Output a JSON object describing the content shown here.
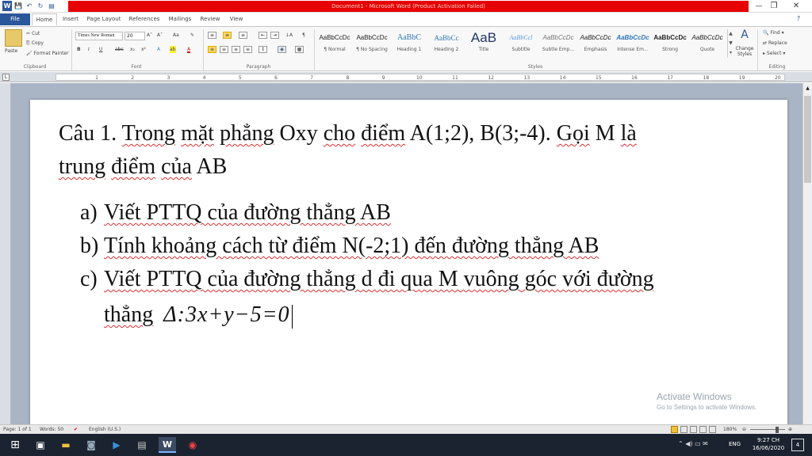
{
  "window": {
    "title": "Document1 - Microsoft Word (Product Activation Failed)",
    "app_icon": "W",
    "minimize": "—",
    "restore": "❐",
    "close": "✕",
    "help": "?"
  },
  "qat": {
    "save": "💾",
    "undo": "↶",
    "redo": "↻",
    "print": "▤"
  },
  "tabs": [
    {
      "label": "File"
    },
    {
      "label": "Home"
    },
    {
      "label": "Insert"
    },
    {
      "label": "Page Layout"
    },
    {
      "label": "References"
    },
    {
      "label": "Mailings"
    },
    {
      "label": "Review"
    },
    {
      "label": "View"
    }
  ],
  "clipboard": {
    "paste": "Paste",
    "cut": "Cut",
    "copy": "Copy",
    "format_painter": "Format Painter",
    "group": "Clipboard"
  },
  "font": {
    "name": "Times New Roman",
    "size": "20",
    "group": "Font",
    "bold": "B",
    "italic": "I",
    "underline": "U",
    "strike": "abc",
    "sub": "x₂",
    "sup": "x²",
    "grow": "A˄",
    "shrink": "A˅",
    "case": "Aa",
    "clear": "✎",
    "effects": "A",
    "highlight": "ab",
    "color": "A"
  },
  "paragraph": {
    "group": "Paragraph",
    "show": "¶",
    "sort": "↓A"
  },
  "styles": {
    "group": "Styles",
    "items": [
      {
        "preview": "AaBbCcDc",
        "name": "¶ Normal"
      },
      {
        "preview": "AaBbCcDc",
        "name": "¶ No Spacing"
      },
      {
        "preview": "AaBbC",
        "name": "Heading 1"
      },
      {
        "preview": "AaBbCc",
        "name": "Heading 2"
      },
      {
        "preview": "AaB",
        "name": "Title"
      },
      {
        "preview": "AaBbCcl",
        "name": "Subtitle"
      },
      {
        "preview": "AaBbCcDc",
        "name": "Subtle Emp..."
      },
      {
        "preview": "AaBbCcDc",
        "name": "Emphasis"
      },
      {
        "preview": "AaBbCcDc",
        "name": "Intense Em..."
      },
      {
        "preview": "AaBbCcDc",
        "name": "Strong"
      },
      {
        "preview": "AaBbCcDc",
        "name": "Quote"
      }
    ],
    "change": "Change Styles"
  },
  "editing": {
    "group": "Editing",
    "find": "Find",
    "replace": "Replace",
    "select": "Select"
  },
  "ruler": {
    "ticks": [
      "1",
      "2",
      "3",
      "4",
      "5",
      "6",
      "7",
      "8",
      "9",
      "10",
      "11",
      "12",
      "13",
      "14",
      "15",
      "16",
      "17",
      "18",
      "19",
      "20"
    ]
  },
  "document": {
    "q_label": "Câu 1.",
    "q_line1_words": [
      "Trong",
      "mặt",
      "phẳng",
      "Oxy",
      "cho",
      "điểm",
      "A(1;2),",
      "B(3;-4).",
      "Gọi",
      "M",
      "là"
    ],
    "q_line2_words": [
      "trung",
      "điểm",
      "của",
      "AB"
    ],
    "items": [
      {
        "marker": "a)",
        "text": "Viết PTTQ của đường thẳng AB"
      },
      {
        "marker": "b)",
        "text": "Tính khoảng cách từ điểm N(-2;1) đến đường thẳng AB"
      },
      {
        "marker": "c)",
        "text": "Viết PTTQ của đường thẳng d đi qua M vuông góc với đường"
      }
    ],
    "c_cont": "thẳng",
    "equation": "Δ:3x+y−5=0"
  },
  "activation": {
    "line1": "Activate Windows",
    "line2": "Go to Settings to activate Windows."
  },
  "status": {
    "page": "Page: 1 of 1",
    "words": "Words: 50",
    "language": "English (U.S.)",
    "zoom": "180%"
  },
  "taskbar": {
    "time": "9:27 CH",
    "date": "16/06/2020",
    "lang": "ENG",
    "notif": "4"
  },
  "colors": {
    "accent": "#2b579a",
    "title_bar": "#e60000",
    "spell_squiggle": "#e03030",
    "taskbar": "#1b2330"
  }
}
